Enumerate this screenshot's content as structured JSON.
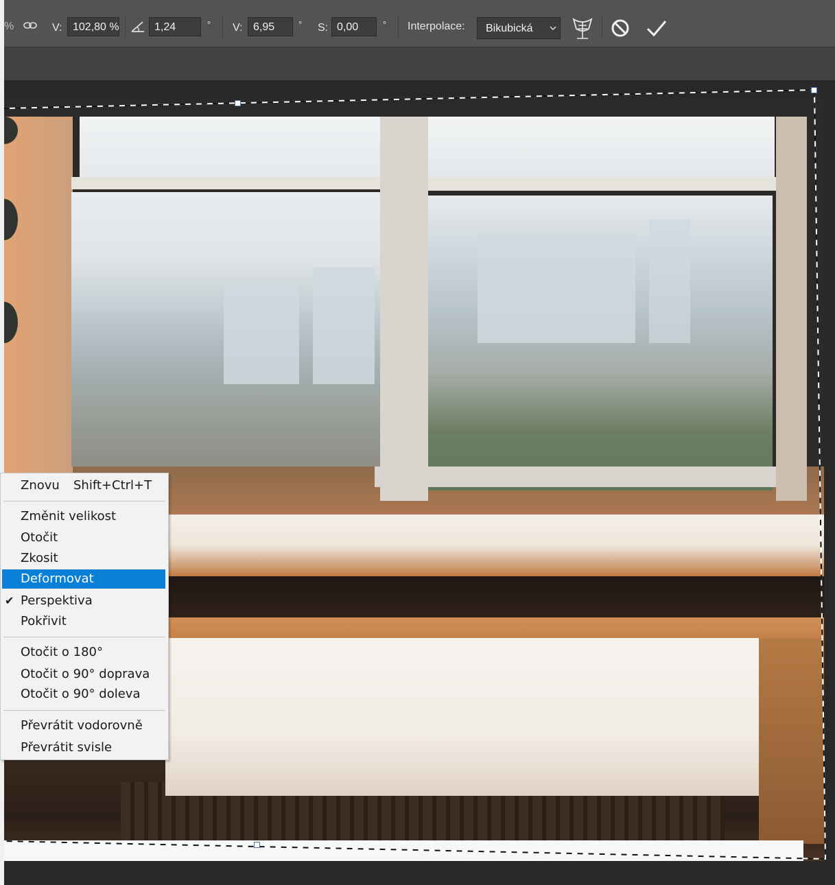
{
  "options_bar": {
    "link_icon": "chain-link-icon",
    "v_label": "V:",
    "v_value": "102,80 %",
    "angle_icon": "angle-icon",
    "angle_value": "1,24",
    "deg": "°",
    "hskew_label": "V:",
    "hskew_value": "6,95",
    "vskew_label": "S:",
    "vskew_value": "0,00",
    "interp_label": "Interpolace:",
    "interp_value": "Bikubická",
    "warp_icon": "warp-icon",
    "cancel_icon": "cancel-icon",
    "commit_icon": "commit-check-icon"
  },
  "context_menu": {
    "again_label": "Znovu",
    "again_shortcut": "Shift+Ctrl+T",
    "items_group1": [
      "Změnit velikost",
      "Otočit",
      "Zkosit",
      "Deformovat",
      "Perspektiva",
      "Pokřivit"
    ],
    "items_group2": [
      "Otočit o 180°",
      "Otočit o 90° doprava",
      "Otočit o 90° doleva"
    ],
    "items_group3": [
      "Převrátit vodorovně",
      "Převrátit svisle"
    ],
    "highlighted": "Deformovat",
    "checked": "Perspektiva"
  },
  "colors": {
    "menu_highlight": "#0a7fd8",
    "toolbar_bg": "#535353",
    "canvas_bg": "#282828"
  }
}
